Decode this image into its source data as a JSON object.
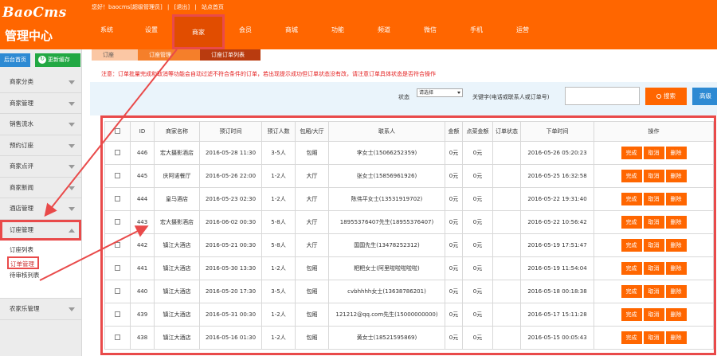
{
  "logo": {
    "brand": "BaoCms",
    "subtitle": "管理中心"
  },
  "header": {
    "greeting": "您好！baocms[超级管理员]",
    "logout": "[退出]",
    "site_home": "站点首页",
    "nav": [
      "系统",
      "设置",
      "商家",
      "会员",
      "商城",
      "功能",
      "频道",
      "微信",
      "手机",
      "运营"
    ],
    "active_nav": "商家"
  },
  "sidebar": {
    "home_button": "后台首页",
    "refresh_button": "更新缓存",
    "items": [
      "商家分类",
      "商家管理",
      "销售流水",
      "预约订座",
      "商家点评",
      "商家新闻",
      "酒店管理"
    ],
    "open_item": "订座管理",
    "sub_items": [
      "订座列表",
      "订单管理",
      "待审核列表"
    ],
    "after_item": "农家乐管理"
  },
  "breadcrumb": [
    "订座",
    "订座管理",
    "订座订单列表"
  ],
  "notice": "注意：订单批量完成和取消等功能会自动过滤不符合条件的订单，若出现提示成功但订单状态没有改，请注意订单具体状态是否符合操作",
  "search": {
    "status_label": "状态",
    "status_value": "请选择",
    "keyword_label": "关键字(电话或联系人或订单号)",
    "search_button": "搜索",
    "advanced_button": "高级"
  },
  "table": {
    "columns": [
      "ID",
      "商家名称",
      "预订时间",
      "预订人数",
      "包厢/大厅",
      "联系人",
      "金额",
      "点菜金额",
      "订单状态",
      "下单时间",
      "操作"
    ],
    "rows": [
      [
        "446",
        "宏大摄影酒店",
        "2016-05-28 11:30",
        "3-5人",
        "包厢",
        "李女士(15066252359)",
        "0元",
        "0元",
        "",
        "2016-05-26 05:20:23"
      ],
      [
        "445",
        "庆阿诺餐厅",
        "2016-05-26 22:00",
        "1-2人",
        "大厅",
        "张女士(15856961926)",
        "0元",
        "0元",
        "",
        "2016-05-25 16:32:58"
      ],
      [
        "444",
        "皇马酒店",
        "2016-05-23 02:30",
        "1-2人",
        "大厅",
        "陈伟平女士(13531919702)",
        "0元",
        "0元",
        "",
        "2016-05-22 19:31:40"
      ],
      [
        "443",
        "宏大摄影酒店",
        "2016-06-02 00:30",
        "5-8人",
        "大厅",
        "18955376407先生(18955376407)",
        "0元",
        "0元",
        "",
        "2016-05-22 10:56:42"
      ],
      [
        "442",
        "镇江大酒店",
        "2016-05-21 00:30",
        "5-8人",
        "大厅",
        "国国先生(13478252312)",
        "0元",
        "0元",
        "",
        "2016-05-19 17:51:47"
      ],
      [
        "441",
        "镇江大酒店",
        "2016-05-30 13:30",
        "1-2人",
        "包厢",
        "粑粑女士(阿里啦啦啦啦啦)",
        "0元",
        "0元",
        "",
        "2016-05-19 11:54:04"
      ],
      [
        "440",
        "镇江大酒店",
        "2016-05-20 17:30",
        "3-5人",
        "包厢",
        "cvbhhhh女士(13638786201)",
        "0元",
        "0元",
        "",
        "2016-05-18 00:18:38"
      ],
      [
        "439",
        "镇江大酒店",
        "2016-05-31 00:30",
        "1-2人",
        "包厢",
        "121212@qq.com先生(15000000000)",
        "0元",
        "0元",
        "",
        "2016-05-17 15:11:28"
      ],
      [
        "438",
        "镇江大酒店",
        "2016-05-16 01:30",
        "1-2人",
        "包厢",
        "黄女士(18521595869)",
        "0元",
        "0元",
        "",
        "2016-05-15 00:05:43"
      ]
    ],
    "actions": [
      "完成",
      "取消",
      "删除"
    ]
  },
  "colors": {
    "brand": "#ff6600",
    "annotation": "#e94a4a",
    "home_button": "#2d8ad3",
    "refresh_button": "#22a843"
  }
}
